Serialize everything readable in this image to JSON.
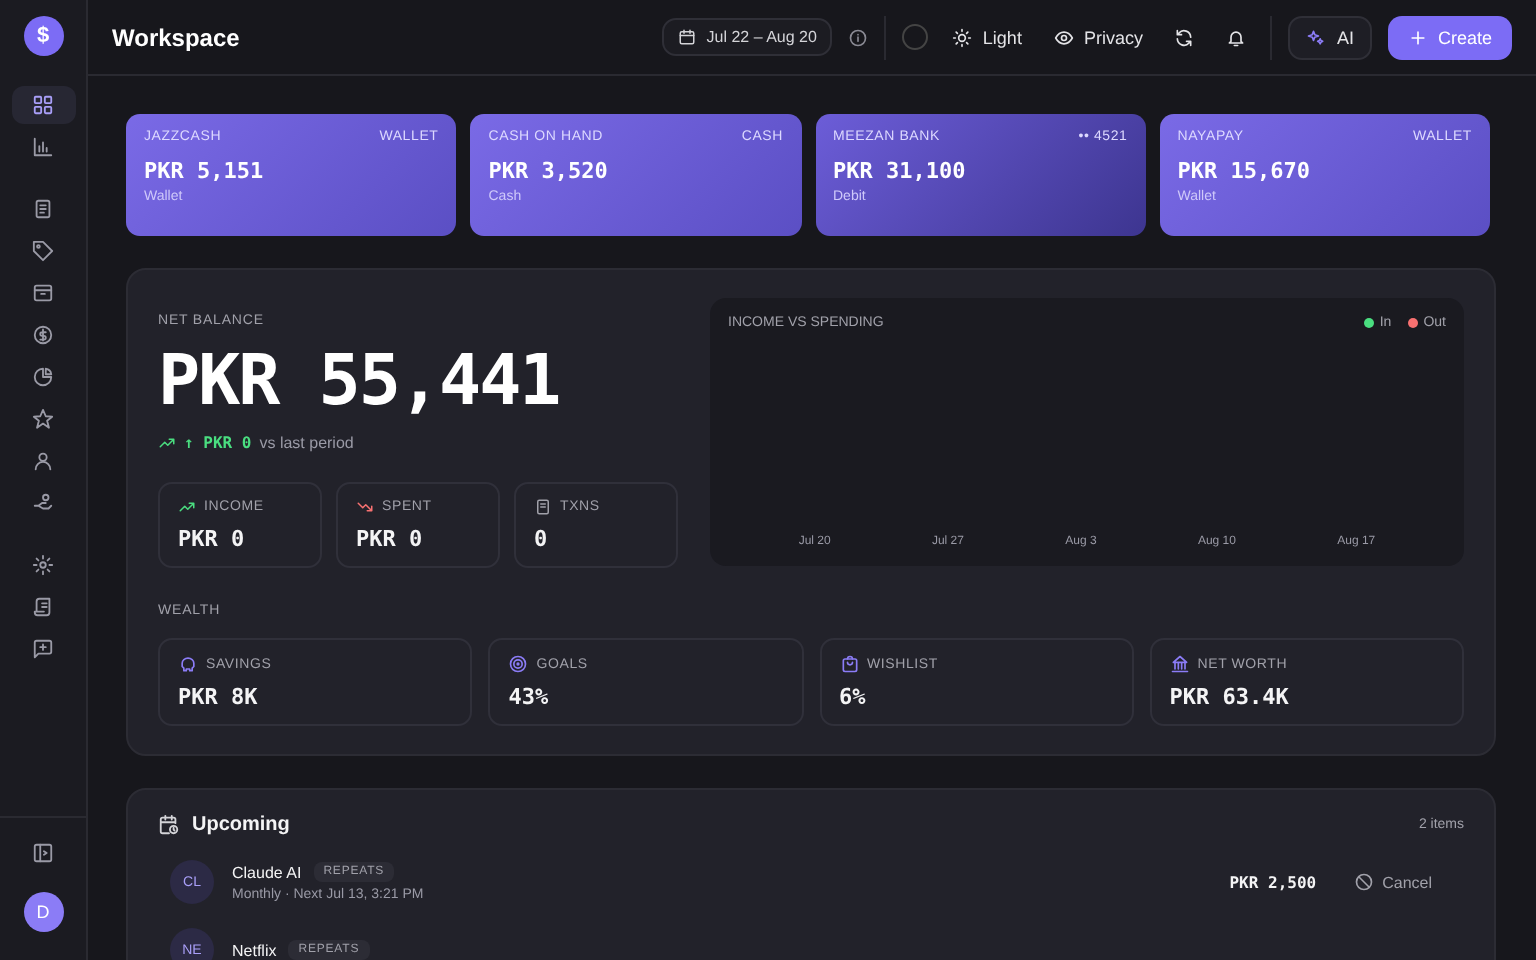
{
  "sidebar": {
    "logo": "$",
    "items": [
      {
        "selected": true
      },
      {
        "selected": false
      },
      {
        "selected": false
      },
      {
        "selected": false
      },
      {
        "selected": false
      },
      {
        "selected": false
      },
      {
        "selected": false
      },
      {
        "selected": false
      },
      {
        "selected": false
      },
      {
        "selected": false
      },
      {
        "selected": false
      },
      {
        "selected": false
      },
      {
        "selected": false
      }
    ],
    "avatar": "D"
  },
  "header": {
    "title": "Workspace",
    "date_range": "Jul 22 – Aug 20",
    "buttons": [
      {
        "kind": "theme",
        "label": "Light"
      },
      {
        "kind": "privacy",
        "label": "Privacy"
      }
    ],
    "ai_button": "AI",
    "create_button": "Create"
  },
  "accounts": [
    {
      "name": "JAZZCASH",
      "tag": "WALLET",
      "amount": "PKR 5,151",
      "subtitle": "Wallet"
    },
    {
      "name": "CASH ON HAND",
      "tag": "CASH",
      "amount": "PKR 3,520",
      "subtitle": "Cash"
    },
    {
      "name": "MEEZAN BANK",
      "tag": "•• 4521",
      "amount": "PKR 31,100",
      "subtitle": "Debit"
    },
    {
      "name": "NAYAPAY",
      "tag": "WALLET",
      "amount": "PKR 15,670",
      "subtitle": "Wallet"
    }
  ],
  "net_balance": {
    "label": "NET BALANCE",
    "amount": "PKR 55,441",
    "change": "↑ PKR 0",
    "change_note": "vs last period",
    "stats": [
      {
        "kind": "income",
        "label": "INCOME",
        "value": "PKR 0"
      },
      {
        "kind": "spent",
        "label": "SPENT",
        "value": "PKR 0"
      },
      {
        "kind": "txns",
        "label": "TXNS",
        "value": "0"
      }
    ]
  },
  "chart": {
    "title": "INCOME VS SPENDING",
    "legend": [
      {
        "label": "In",
        "color": "#4ade80"
      },
      {
        "label": "Out",
        "color": "#f87171"
      }
    ],
    "x_labels": [
      "Jul 20",
      "Jul 27",
      "Aug 3",
      "Aug 10",
      "Aug 17"
    ]
  },
  "wealth": {
    "label": "WEALTH",
    "items": [
      {
        "kind": "savings",
        "label": "SAVINGS",
        "value": "PKR 8K"
      },
      {
        "kind": "goals",
        "label": "GOALS",
        "value": "43%"
      },
      {
        "kind": "wishlist",
        "label": "WISHLIST",
        "value": "6%"
      },
      {
        "kind": "net_worth",
        "label": "NET WORTH",
        "value": "PKR 63.4K"
      }
    ]
  },
  "upcoming": {
    "title": "Upcoming",
    "count": "2 items",
    "items": [
      {
        "initials": "CL",
        "name": "Claude AI",
        "badge": "REPEATS",
        "detail": "Monthly · Next Jul 13, 3:21 PM",
        "amount": "PKR 2,500",
        "action": "Cancel"
      },
      {
        "initials": "NE",
        "name": "Netflix",
        "badge": "REPEATS"
      }
    ]
  }
}
